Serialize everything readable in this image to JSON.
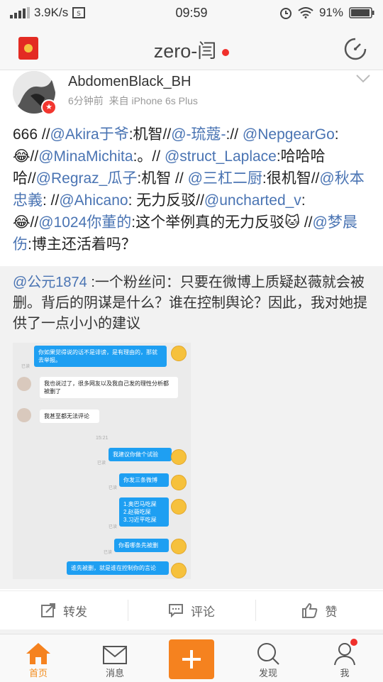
{
  "status": {
    "speed": "3.9K/s",
    "time": "09:59",
    "battery": "91%"
  },
  "header": {
    "title": "zero-闫"
  },
  "post": {
    "username": "AbdomenBlack_BH",
    "time_ago": "6分钟前",
    "source": "来自 iPhone 6s Plus",
    "text_parts": [
      "666 //",
      "@Akira于爷",
      ":机智//",
      "@-琉蔻-",
      "://",
      "@NepgearGo",
      ":😂//",
      "@MinaMichita",
      ":。//",
      "@struct_Laplace",
      ":哈哈哈哈//",
      "@Regraz_瓜子",
      ":机智 //",
      "@三杠二厨",
      ":很机智//",
      "@秋本忠義",
      ": //",
      "@Ahicano",
      ": 无力反驳//",
      "@uncharted_v",
      ":😂//",
      "@1024你董的",
      ":这个举例真的无力反驳🐱 //",
      "@梦晨伤",
      ":博主还活着吗？"
    ]
  },
  "repost": {
    "author": "@公元1874",
    "text": " :一个粉丝问：只要在微博上质疑赵薇就会被删。背后的阴谋是什么？谁在控制舆论？因此，我对她提供了一点小小的建议"
  },
  "chat": {
    "messages": [
      {
        "text": "你如果觉得说的话不是诽谤，是有理由的，那就去举报。"
      },
      {
        "text": "我也说过了，很多网友以及我自己发的理性分析都被删了"
      },
      {
        "text": "我甚至都无法评论"
      },
      {
        "text": "15:21"
      },
      {
        "text": "我建议你做个试验"
      },
      {
        "text": "你发三条微博"
      },
      {
        "text": "1.奥巴马吃屎\n2.赵薇吃屎\n3.习近平吃屎"
      },
      {
        "text": "你看哪条先被删"
      },
      {
        "text": "谁先被删，就是谁在控制你的言论"
      }
    ],
    "read_label": "已读"
  },
  "actions": {
    "repost": "转发",
    "comment": "评论",
    "like": "赞"
  },
  "tabs": {
    "home": "首页",
    "messages": "消息",
    "discover": "发现",
    "me": "我"
  },
  "colors": {
    "accent": "#f5821f",
    "mention": "#4a74b3",
    "chat_blue": "#1e9ff2"
  }
}
